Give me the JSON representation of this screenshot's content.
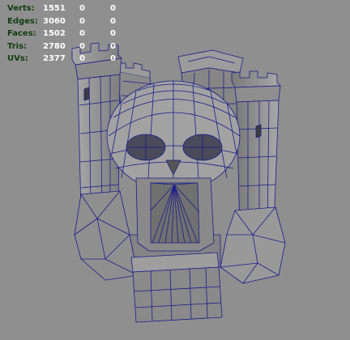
{
  "viewport": {
    "name": "3D Perspective Viewport",
    "background_color": "#8f8f8f",
    "wireframe_color": "#1c1c8c",
    "mesh_color": "#9a9a9a"
  },
  "hud": {
    "label_color": "#123d12",
    "value_color": "#ffffff",
    "rows": [
      {
        "label": "Verts:",
        "total": "1551",
        "selected": "0",
        "component": "0"
      },
      {
        "label": "Edges:",
        "total": "3060",
        "selected": "0",
        "component": "0"
      },
      {
        "label": "Faces:",
        "total": "1502",
        "selected": "0",
        "component": "0"
      },
      {
        "label": "Tris:",
        "total": "2780",
        "selected": "0",
        "component": "0"
      },
      {
        "label": "UVs:",
        "total": "2377",
        "selected": "0",
        "component": "0"
      }
    ]
  },
  "model": {
    "description_icon": "castle-skull-wireframe"
  }
}
